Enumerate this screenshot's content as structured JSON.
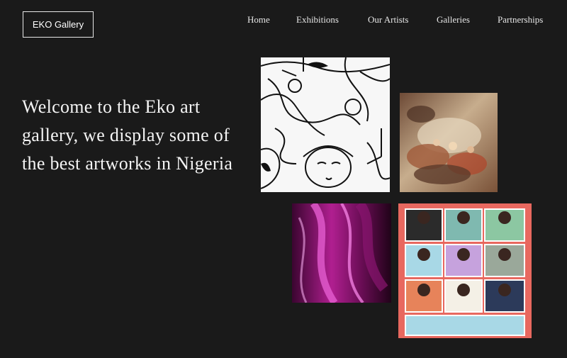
{
  "header": {
    "logo_label": "EKO Gallery",
    "nav": [
      "Home",
      "Exhibitions",
      "Our Artists",
      "Galleries",
      "Partnerships"
    ]
  },
  "hero": {
    "heading": "Welcome to the Eko art gallery, we display some of the best artworks in Nigeria"
  },
  "artworks": [
    {
      "name": "line-drawing-faces",
      "palette": [
        "#ffffff",
        "#111111"
      ]
    },
    {
      "name": "baroque-ceiling-painting",
      "palette": [
        "#8a5a3c",
        "#c9b38f",
        "#e9dcc5"
      ]
    },
    {
      "name": "purple-abstract-fluid",
      "palette": [
        "#6a0a4a",
        "#d12fb0",
        "#2a0420"
      ]
    },
    {
      "name": "colorful-figures-grid",
      "palette": [
        "#e8685f",
        "#7fb9b0",
        "#c6a2dd",
        "#f4f0e6"
      ]
    }
  ],
  "colors": {
    "background": "#1a1a1a",
    "text": "#f2f2f2"
  }
}
